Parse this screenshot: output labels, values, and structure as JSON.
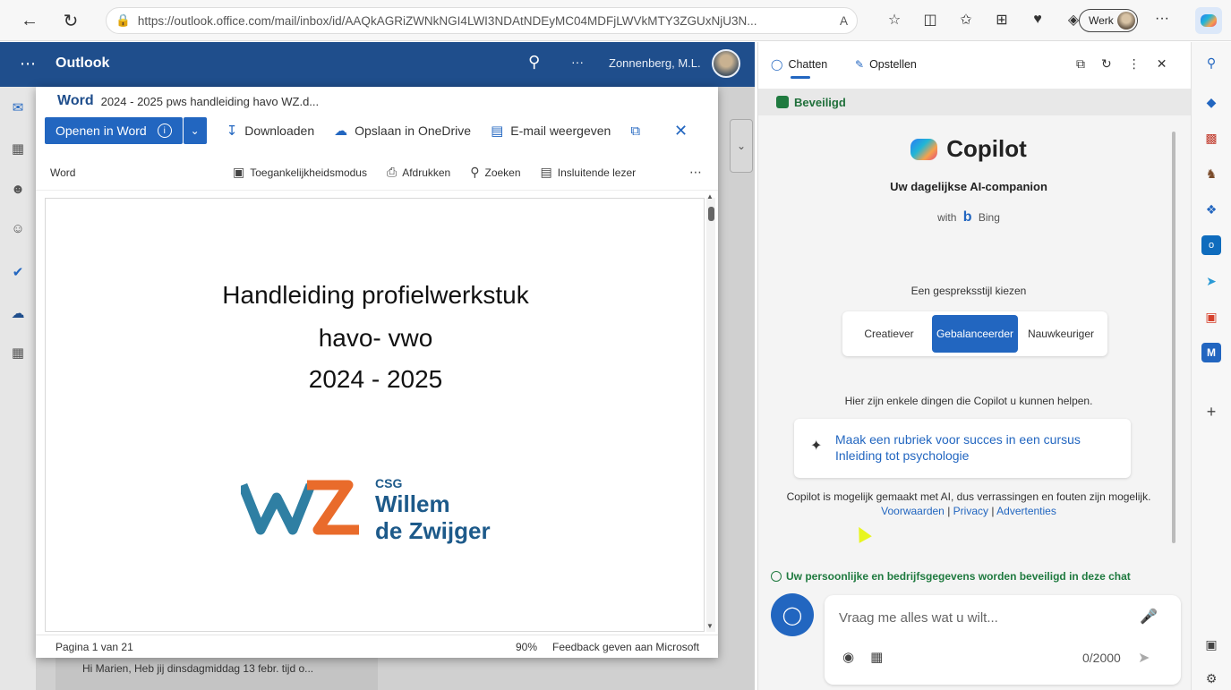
{
  "browser": {
    "url": "https://outlook.office.com/mail/inbox/id/AAQkAGRiZWNkNGI4LWI3NDAtNDEyMC04MDFjLWVkMTY3ZGUxNjU3N...",
    "profile": "Werk",
    "reader_label": "A",
    "more": "···"
  },
  "outlook": {
    "title": "Outlook",
    "user": "Zonnenberg, M.L.",
    "dots": "···",
    "bg_preview": "Hi Marien, Heb jij dinsdagmiddag 13 febr. tijd o..."
  },
  "word_preview": {
    "app": "Word",
    "filename": "2024 - 2025 pws handleiding havo WZ.d...",
    "open_label": "Openen in Word",
    "download_label": "Downloaden",
    "save_label": "Opslaan in OneDrive",
    "email_label": "E-mail weergeven",
    "toolbar_label": "Word",
    "accessibility_label": "Toegankelijkheidsmodus",
    "print_label": "Afdrukken",
    "search_label": "Zoeken",
    "reader_label": "Insluitende lezer",
    "doc_title_1": "Handleiding profielwerkstuk",
    "doc_title_2": "havo- vwo",
    "doc_title_3": "2024 - 2025",
    "logo_csg": "CSG",
    "logo_line1": "Willem",
    "logo_line2": "de Zwijger",
    "page_info": "Pagina 1 van 21",
    "zoom": "90%",
    "feedback": "Feedback geven aan Microsoft"
  },
  "copilot": {
    "tab_chat": "Chatten",
    "tab_compose": "Opstellen",
    "secure_label": "Beveiligd",
    "name": "Copilot",
    "subtitle": "Uw dagelijkse AI-companion",
    "with_label": "with",
    "bing_label": "Bing",
    "style_prompt": "Een gespreksstijl kiezen",
    "styles": [
      "Creatiever",
      "Gebalanceerder",
      "Nauwkeuriger"
    ],
    "active_style": "Gebalanceerder",
    "help_text": "Hier zijn enkele dingen die Copilot u kunnen helpen.",
    "suggestion_line1": "Maak een rubriek voor succes in een cursus",
    "suggestion_line2": "Inleiding tot psychologie",
    "disclaimer": "Copilot is mogelijk gemaakt met AI, dus verrassingen en fouten zijn mogelijk.",
    "link_terms": "Voorwaarden",
    "link_privacy": "Privacy",
    "link_ads": "Advertenties",
    "separator": "|",
    "protected_notice": "Uw persoonlijke en bedrijfsgegevens worden beveiligd in deze chat",
    "input_placeholder": "Vraag me alles wat u wilt...",
    "char_count": "0/2000"
  }
}
